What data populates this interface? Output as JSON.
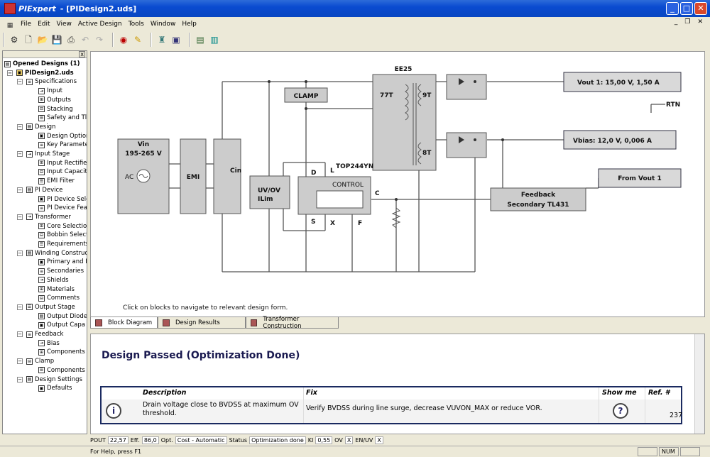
{
  "window": {
    "app": "PIExpert",
    "document": "- [PIDesign2.uds]",
    "min": "_",
    "max": "□",
    "close": "✕"
  },
  "menu": [
    "File",
    "Edit",
    "View",
    "Active Design",
    "Tools",
    "Window",
    "Help"
  ],
  "mdi": {
    "min": "_",
    "restore": "❐",
    "close": "✕"
  },
  "tree": {
    "close": "x",
    "items": [
      {
        "label": "Opened Designs (1)",
        "level": 0,
        "bold": true
      },
      {
        "label": "PIDesign2.uds",
        "level": 1,
        "bold": true
      },
      {
        "label": "Specifications",
        "level": 2
      },
      {
        "label": "Input",
        "level": 3
      },
      {
        "label": "Outputs",
        "level": 3
      },
      {
        "label": "Stacking",
        "level": 3
      },
      {
        "label": "Safety and Tl",
        "level": 3
      },
      {
        "label": "Design",
        "level": 2
      },
      {
        "label": "Design Optior",
        "level": 3
      },
      {
        "label": "Key Paramete",
        "level": 3
      },
      {
        "label": "Input Stage",
        "level": 2
      },
      {
        "label": "Input Rectifie",
        "level": 3
      },
      {
        "label": "Input Capacit",
        "level": 3
      },
      {
        "label": "EMI Filter",
        "level": 3
      },
      {
        "label": "PI Device",
        "level": 2
      },
      {
        "label": "PI Device Sele",
        "level": 3
      },
      {
        "label": "PI Device Fea",
        "level": 3
      },
      {
        "label": "Transformer",
        "level": 2
      },
      {
        "label": "Core Selectio",
        "level": 3
      },
      {
        "label": "Bobbin Select",
        "level": 3
      },
      {
        "label": "Requirements",
        "level": 3
      },
      {
        "label": "Winding Construc",
        "level": 2
      },
      {
        "label": "Primary and E",
        "level": 3
      },
      {
        "label": "Secondaries",
        "level": 3
      },
      {
        "label": "Shields",
        "level": 3
      },
      {
        "label": "Materials",
        "level": 3
      },
      {
        "label": "Comments",
        "level": 3
      },
      {
        "label": "Output Stage",
        "level": 2
      },
      {
        "label": "Output Diode",
        "level": 3
      },
      {
        "label": "Output Capa",
        "level": 3
      },
      {
        "label": "Feedback",
        "level": 2
      },
      {
        "label": "Bias",
        "level": 3
      },
      {
        "label": "Components",
        "level": 3
      },
      {
        "label": "Clamp",
        "level": 2
      },
      {
        "label": "Components",
        "level": 3
      },
      {
        "label": "Design Settings",
        "level": 2
      },
      {
        "label": "Defaults",
        "level": 3
      }
    ]
  },
  "diagram": {
    "vin": "Vin",
    "vin_range": "195-265 V",
    "ac": "AC",
    "emi": "EMI",
    "cin": "Cin",
    "clamp": "CLAMP",
    "uvov": "UV/OV",
    "ilim": "ILim",
    "device": "TOP244YN",
    "control": "CONTROL",
    "pin_d": "D",
    "pin_l": "L",
    "pin_s": "S",
    "pin_x": "X",
    "pin_f": "F",
    "pin_c": "C",
    "core": "EE25",
    "primary": "77T",
    "sec1": "9T",
    "sec2": "8T",
    "vout1": "Vout 1:  15,00 V,  1,50 A",
    "vbias": "Vbias: 12,0 V,  0,006 A",
    "rtn": "RTN",
    "from_vout": "From Vout 1",
    "feedback1": "Feedback",
    "feedback2": "Secondary TL431",
    "hint": "Click on blocks to navigate to relevant design form."
  },
  "tabs": [
    {
      "label": "Block Diagram",
      "active": true
    },
    {
      "label": "Design Results"
    },
    {
      "label": "Transformer Construction"
    }
  ],
  "results": {
    "title": "Design Passed (Optimization Done)",
    "headers": {
      "description": "Description",
      "fix": "Fix",
      "show": "Show me",
      "ref": "Ref. #"
    },
    "row": {
      "description": "Drain voltage close to BVDSS at maximum OV threshold.",
      "fix": "Verify BVDSS during line surge, decrease VUVON_MAX or reduce VOR.",
      "ref": "237"
    }
  },
  "status": {
    "pout_l": "POUT",
    "pout": "22,57",
    "eff_l": "Eff.",
    "eff": "86,0",
    "opt_l": "Opt.",
    "opt": "Cost - Automatic",
    "status_l": "Status",
    "status": "Optimization done",
    "kt_l": "KI",
    "kt": "0,55",
    "ov_l": "OV",
    "ov": "X",
    "enuv_l": "EN/UV",
    "enuv": "X"
  },
  "help": {
    "text": "For Help, press F1",
    "num": "NUM"
  }
}
